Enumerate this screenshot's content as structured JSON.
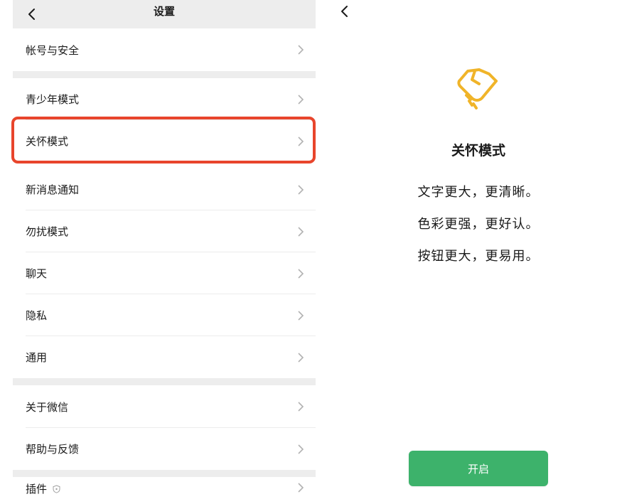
{
  "settings": {
    "title": "设置",
    "items": [
      {
        "label": "帐号与安全"
      },
      {
        "label": "青少年模式"
      },
      {
        "label": "关怀模式"
      },
      {
        "label": "新消息通知"
      },
      {
        "label": "勿扰模式"
      },
      {
        "label": "聊天"
      },
      {
        "label": "隐私"
      },
      {
        "label": "通用"
      },
      {
        "label": "关于微信"
      },
      {
        "label": "帮助与反馈"
      },
      {
        "label": "插件"
      }
    ],
    "highlighted_item": "关怀模式",
    "highlight_color": "#e8452c"
  },
  "care_mode": {
    "title": "关怀模式",
    "lines": [
      "文字更大，更清晰。",
      "色彩更强，更好认。",
      "按钮更大，更易用。"
    ],
    "button_label": "开启",
    "button_color": "#3db26b",
    "icon": "care-hand-icon",
    "icon_color": "#f0b429"
  }
}
